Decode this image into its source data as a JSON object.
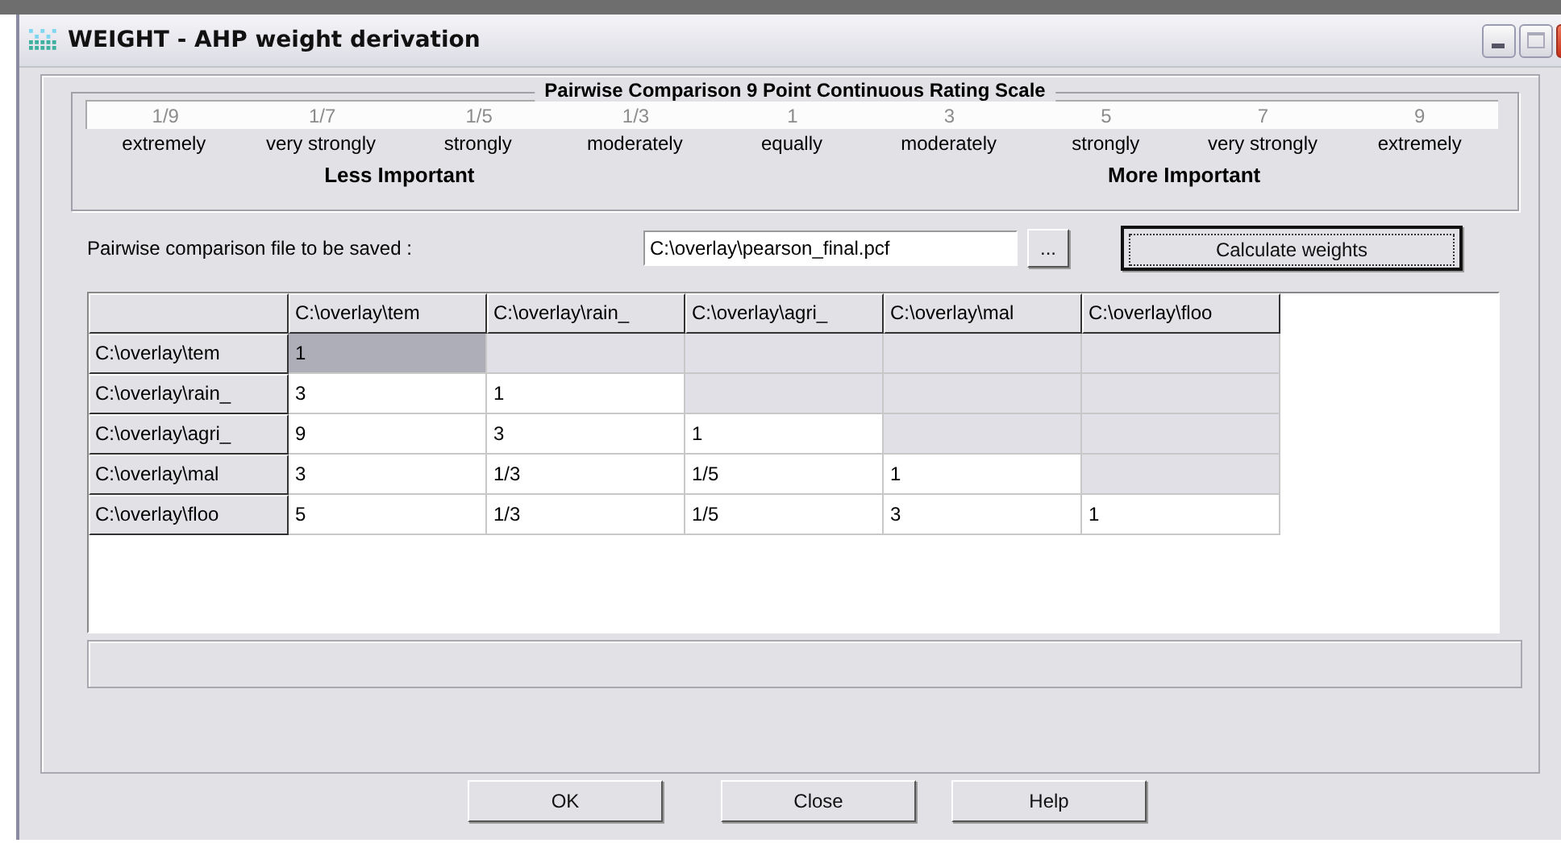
{
  "window": {
    "title": "WEIGHT - AHP weight derivation"
  },
  "scale": {
    "title": "Pairwise Comparison 9 Point Continuous Rating Scale",
    "points": [
      {
        "value": "1/9",
        "label": "extremely"
      },
      {
        "value": "1/7",
        "label": "very strongly"
      },
      {
        "value": "1/5",
        "label": "strongly"
      },
      {
        "value": "1/3",
        "label": "moderately"
      },
      {
        "value": "1",
        "label": "equally"
      },
      {
        "value": "3",
        "label": "moderately"
      },
      {
        "value": "5",
        "label": "strongly"
      },
      {
        "value": "7",
        "label": "very strongly"
      },
      {
        "value": "9",
        "label": "extremely"
      }
    ],
    "less_label": "Less Important",
    "more_label": "More Important"
  },
  "file": {
    "label": "Pairwise comparison file to be saved :",
    "value": "C:\\overlay\\pearson_final.pcf",
    "browse": "...",
    "calculate": "Calculate weights",
    "calculate_focused": true
  },
  "grid": {
    "columns": [
      "C:\\overlay\\tem",
      "C:\\overlay\\rain_",
      "C:\\overlay\\agri_",
      "C:\\overlay\\mal",
      "C:\\overlay\\floo"
    ],
    "rows": [
      {
        "header": "C:\\overlay\\tem",
        "cells": [
          {
            "value": "1",
            "disabled": false,
            "selected": true
          },
          {
            "disabled": true,
            "selected": false
          },
          {
            "disabled": true,
            "selected": false
          },
          {
            "disabled": true,
            "selected": false
          },
          {
            "disabled": true,
            "selected": false
          }
        ]
      },
      {
        "header": "C:\\overlay\\rain_",
        "cells": [
          {
            "value": "3",
            "disabled": false,
            "selected": false
          },
          {
            "value": "1",
            "disabled": false,
            "selected": false
          },
          {
            "disabled": true,
            "selected": false
          },
          {
            "disabled": true,
            "selected": false
          },
          {
            "disabled": true,
            "selected": false
          }
        ]
      },
      {
        "header": "C:\\overlay\\agri_",
        "cells": [
          {
            "value": "9",
            "disabled": false,
            "selected": false
          },
          {
            "value": "3",
            "disabled": false,
            "selected": false
          },
          {
            "value": "1",
            "disabled": false,
            "selected": false
          },
          {
            "disabled": true,
            "selected": false
          },
          {
            "disabled": true,
            "selected": false
          }
        ]
      },
      {
        "header": "C:\\overlay\\mal",
        "cells": [
          {
            "value": "3",
            "disabled": false,
            "selected": false
          },
          {
            "value": "1/3",
            "disabled": false,
            "selected": false
          },
          {
            "value": "1/5",
            "disabled": false,
            "selected": false
          },
          {
            "value": "1",
            "disabled": false,
            "selected": false
          },
          {
            "disabled": true,
            "selected": false
          }
        ]
      },
      {
        "header": "C:\\overlay\\floo",
        "cells": [
          {
            "value": "5",
            "disabled": false,
            "selected": false
          },
          {
            "value": "1/3",
            "disabled": false,
            "selected": false
          },
          {
            "value": "1/5",
            "disabled": false,
            "selected": false
          },
          {
            "value": "3",
            "disabled": false,
            "selected": false
          },
          {
            "value": "1",
            "disabled": false,
            "selected": false
          }
        ]
      }
    ]
  },
  "buttons": [
    "OK",
    "Close",
    "Help"
  ]
}
